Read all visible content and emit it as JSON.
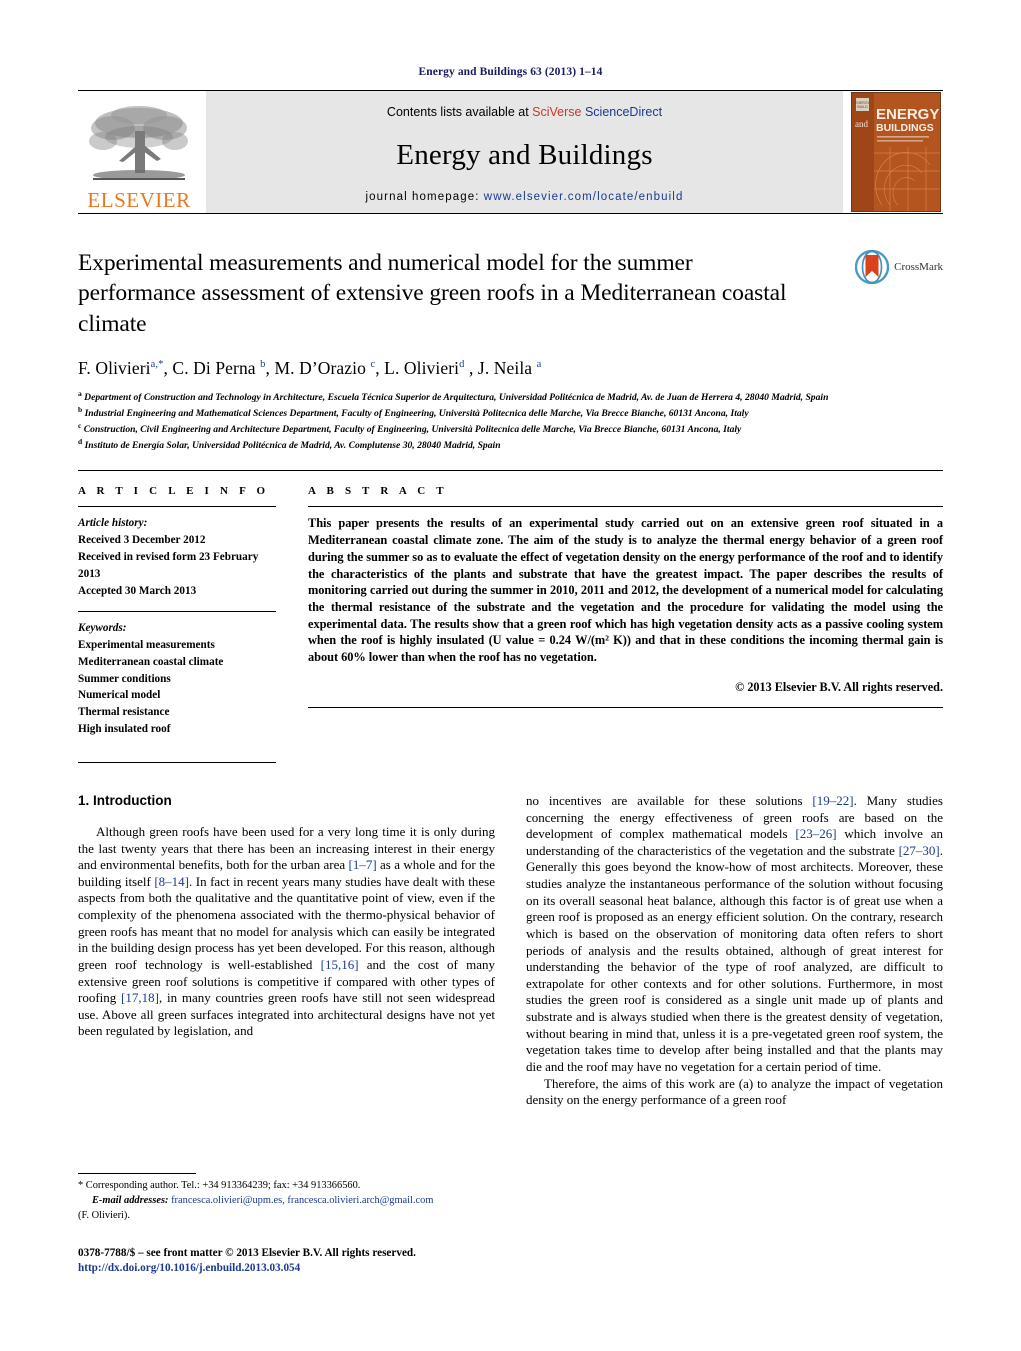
{
  "running_head": "Energy and Buildings 63 (2013) 1–14",
  "journal_header": {
    "publisher_logo_text": "ELSEVIER",
    "contents_prefix": "Contents lists available at ",
    "contents_link_sci": "SciVerse",
    "contents_link_sd": " ScienceDirect",
    "journal_name": "Energy and Buildings",
    "homepage_label": "journal homepage:",
    "homepage_url": "www.elsevier.com/locate/enbuild",
    "cover": {
      "line1": "ENERGY",
      "line2": "and",
      "line3": "BUILDINGS"
    }
  },
  "article": {
    "title": "Experimental measurements and numerical model for the summer performance assessment of extensive green roofs in a Mediterranean coastal climate",
    "crossmark_label": "CrossMark",
    "authors_html": "F. Olivieri<sup>a,</sup><sup class=\"star\">*</sup>, C. Di Perna <sup>b</sup>, M. D'Orazio <sup>c</sup>, L. Olivieri<sup>d</sup> , J. Neila <sup>a</sup>",
    "affiliations": [
      {
        "marker": "a",
        "text": "Department of Construction and Technology in Architecture, Escuela Técnica Superior de Arquitectura, Universidad Politécnica de Madrid, Av. de Juan de Herrera 4, 28040 Madrid, Spain"
      },
      {
        "marker": "b",
        "text": "Industrial Engineering and Mathematical Sciences Department, Faculty of Engineering, Università Politecnica delle Marche, Via Brecce Bianche, 60131 Ancona, Italy"
      },
      {
        "marker": "c",
        "text": "Construction, Civil Engineering and Architecture Department, Faculty of Engineering, Università Politecnica delle Marche, Via Brecce Bianche, 60131 Ancona, Italy"
      },
      {
        "marker": "d",
        "text": "Instituto de Energía Solar, Universidad Politécnica de Madrid, Av. Complutense 30, 28040 Madrid, Spain"
      }
    ]
  },
  "article_info": {
    "section_label": "A R T I C L E    I N F O",
    "history_label": "Article history:",
    "history": [
      "Received 3 December 2012",
      "Received in revised form 23 February 2013",
      "Accepted 30 March 2013"
    ],
    "keywords_label": "Keywords:",
    "keywords": [
      "Experimental measurements",
      "Mediterranean coastal climate",
      "Summer conditions",
      "Numerical model",
      "Thermal resistance",
      "High insulated roof"
    ]
  },
  "abstract": {
    "section_label": "A B S T R A C T",
    "text": "This paper presents the results of an experimental study carried out on an extensive green roof situated in a Mediterranean coastal climate zone. The aim of the study is to analyze the thermal energy behavior of a green roof during the summer so as to evaluate the effect of vegetation density on the energy performance of the roof and to identify the characteristics of the plants and substrate that have the greatest impact. The paper describes the results of monitoring carried out during the summer in 2010, 2011 and 2012, the development of a numerical model for calculating the thermal resistance of the substrate and the vegetation and the procedure for validating the model using the experimental data. The results show that a green roof which has high vegetation density acts as a passive cooling system when the roof is highly insulated (U value = 0.24 W/(m² K)) and that in these conditions the incoming thermal gain is about 60% lower than when the roof has no vegetation.",
    "copyright": "© 2013 Elsevier B.V. All rights reserved."
  },
  "body": {
    "section_number_title": "1.  Introduction",
    "left_paragraphs": [
      "Although green roofs have been used for a very long time it is only during the last twenty years that there has been an increasing interest in their energy and environmental benefits, both for the urban area [1–7] as a whole and for the building itself [8–14]. In fact in recent years many studies have dealt with these aspects from both the qualitative and the quantitative point of view, even if the complexity of the phenomena associated with the thermo-physical behavior of green roofs has meant that no model for analysis which can easily be integrated in the building design process has yet been developed. For this reason, although green roof technology is well-established [15,16] and the cost of many extensive green roof solutions is competitive if compared with other types of roofing [17,18], in many countries green roofs have still not seen widespread use. Above all green surfaces integrated into architectural designs have not yet been regulated by legislation, and"
    ],
    "right_paragraphs": [
      "no incentives are available for these solutions [19–22]. Many studies concerning the energy effectiveness of green roofs are based on the development of complex mathematical models [23–26] which involve an understanding of the characteristics of the vegetation and the substrate [27–30]. Generally this goes beyond the know-how of most architects. Moreover, these studies analyze the instantaneous performance of the solution without focusing on its overall seasonal heat balance, although this factor is of great use when a green roof is proposed as an energy efficient solution. On the contrary, research which is based on the observation of monitoring data often refers to short periods of analysis and the results obtained, although of great interest for understanding the behavior of the type of roof analyzed, are difficult to extrapolate for other contexts and for other solutions. Furthermore, in most studies the green roof is considered as a single unit made up of plants and substrate and is always studied when there is the greatest density of vegetation, without bearing in mind that, unless it is a pre-vegetated green roof system, the vegetation takes time to develop after being installed and that the plants may die and the roof may have no vegetation for a certain period of time.",
      "Therefore, the aims of this work are (a) to analyze the impact of vegetation density on the energy performance of a green roof"
    ]
  },
  "footnote": {
    "corresponding": "* Corresponding author. Tel.: +34 913364239; fax: +34 913366560.",
    "email_label": "E-mail addresses:",
    "emails": "francesca.olivieri@upm.es, francesca.olivieri.arch@gmail.com",
    "email_owner": "(F. Olivieri).",
    "issn_line": "0378-7788/$ – see front matter © 2013 Elsevier B.V. All rights reserved.",
    "doi_line": "http://dx.doi.org/10.1016/j.enbuild.2013.03.054"
  },
  "colors": {
    "link_blue": "#1a3a8f",
    "elsevier_orange": "#E87722",
    "header_band": "#e6e6e6",
    "cover_brown": "#b4541f"
  }
}
